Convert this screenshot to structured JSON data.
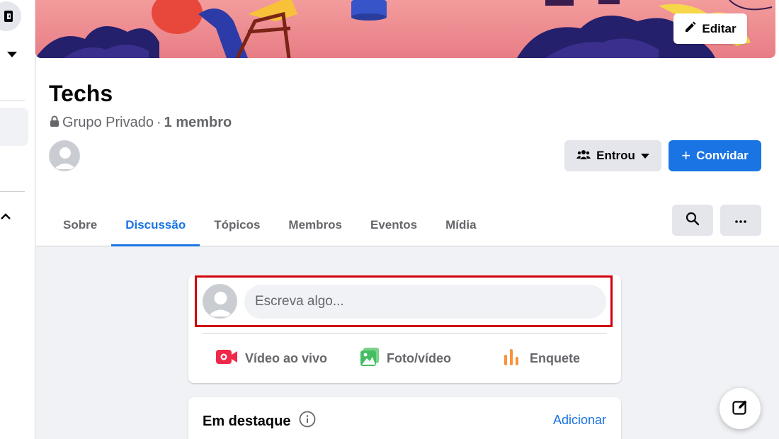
{
  "cover": {
    "edit_label": "Editar"
  },
  "group": {
    "name": "Techs",
    "privacy": "Grupo Privado",
    "separator": "·",
    "members": "1 membro"
  },
  "actions": {
    "joined_label": "Entrou",
    "invite_label": "Convidar",
    "invite_prefix": "+"
  },
  "tabs": [
    {
      "label": "Sobre"
    },
    {
      "label": "Discussão"
    },
    {
      "label": "Tópicos"
    },
    {
      "label": "Membros"
    },
    {
      "label": "Eventos"
    },
    {
      "label": "Mídia"
    }
  ],
  "active_tab": "Discussão",
  "composer": {
    "placeholder": "Escreva algo...",
    "actions": [
      {
        "label": "Vídeo ao vivo",
        "icon": "live-video-icon",
        "color": "#f02849"
      },
      {
        "label": "Foto/vídeo",
        "icon": "photo-icon",
        "color": "#45bd62"
      },
      {
        "label": "Enquete",
        "icon": "poll-icon",
        "color": "#f7923b"
      }
    ]
  },
  "featured": {
    "title": "Em destaque",
    "add_label": "Adicionar"
  },
  "colors": {
    "accent": "#1b74e4",
    "highlight": "#d0000a",
    "secondary_text": "#65676b"
  }
}
